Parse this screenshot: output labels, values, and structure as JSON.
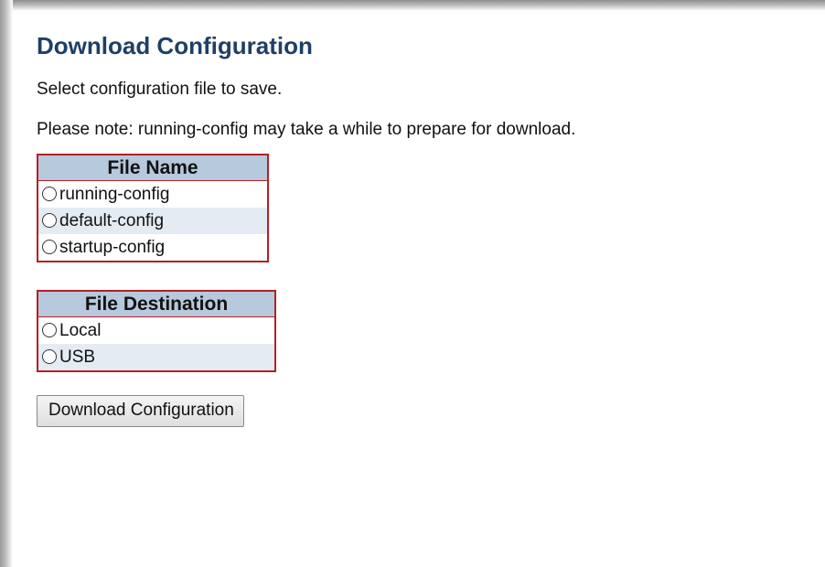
{
  "page": {
    "title": "Download Configuration",
    "instruction": "Select configuration file to save.",
    "note": "Please note: running-config may take a while to prepare for download."
  },
  "file_name_table": {
    "header": "File Name",
    "options": [
      {
        "label": "running-config",
        "selected": false
      },
      {
        "label": "default-config",
        "selected": false
      },
      {
        "label": "startup-config",
        "selected": false
      }
    ]
  },
  "file_destination_table": {
    "header": "File Destination",
    "options": [
      {
        "label": "Local",
        "selected": false
      },
      {
        "label": "USB",
        "selected": false
      }
    ]
  },
  "actions": {
    "download_label": "Download Configuration"
  },
  "colors": {
    "title": "#1f3f66",
    "table_border": "#b51f24",
    "table_header_bg": "#b7c9dc",
    "row_alt_bg": "#e4ebf3"
  }
}
